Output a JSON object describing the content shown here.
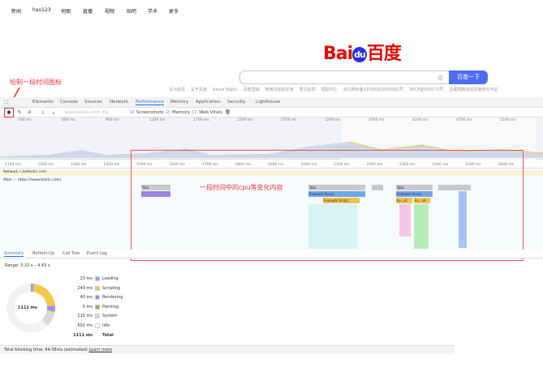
{
  "nav": [
    "新闻",
    "hao123",
    "地图",
    "直播",
    "视频",
    "贴吧",
    "学术",
    "更多"
  ],
  "logo": {
    "left": "Bai",
    "mid": "du",
    "right": "百度"
  },
  "search": {
    "button": "百度一下",
    "value": ""
  },
  "links": [
    "设为首页",
    "关于百度",
    "About Baidu",
    "百度营销",
    "使用百度前必读",
    "意见反馈",
    "帮助中心",
    "京公网安备11000002000001号",
    "京ICP证030173号",
    "互联网新闻信息服务许可证"
  ],
  "annotations": {
    "record": "绘制一段时间图标",
    "cpu": "一段时间中的cpu等变化内容"
  },
  "devtools": {
    "tabs": [
      "Elements",
      "Console",
      "Sources",
      "Network",
      "Performance",
      "Memory",
      "Application",
      "Security",
      "Lighthouse"
    ],
    "active_tab": "Performance",
    "toolbar": {
      "profile_select": "www.baidu.com #1",
      "screenshots": "Screenshots",
      "memory": "Memory",
      "web_vitals": "Web Vitals",
      "screenshots_checked": true,
      "memory_checked": true,
      "web_vitals_checked": false
    },
    "overview_ticks": [
      "100 ms",
      "600 ms",
      "900 ms",
      "1200 ms",
      "1700 ms",
      "2200 ms",
      "2700 ms",
      "3200 ms",
      "3700 ms",
      "4200 ms",
      "4700 ms",
      "5200 ms"
    ],
    "ruler_ticks": [
      "1100 ms",
      "1200 ms",
      "1300 ms",
      "1400 ms",
      "1500 ms",
      "1600 ms",
      "1700 ms",
      "1800 ms",
      "1900 ms",
      "2000 ms",
      "2100 ms",
      "2200 ms",
      "2300 ms",
      "2400 ms",
      "2500 ms",
      "2600 ms"
    ],
    "network_row": "Network  s.bdstatic.com",
    "main_row": "Main — https://www.baidu.com/",
    "flame": [
      {
        "label": "Task",
        "color": "#c8c8c8"
      },
      {
        "label": "Evaluate Script",
        "color": "#f2c14e"
      },
      {
        "label": "Evaluate Script",
        "color": "#f2c14e"
      },
      {
        "label": "Task",
        "color": "#c8c8c8"
      },
      {
        "label": "Evaluate Script",
        "color": "#6fa8f0"
      },
      {
        "label": "Task",
        "color": "#c8c8c8"
      },
      {
        "label": "Evaluate Script",
        "color": "#6fa8f0"
      },
      {
        "label": "Ev...pt",
        "color": "#f2c14e"
      },
      {
        "label": "Ev...ad",
        "color": "#f2c14e"
      }
    ],
    "bottom_tabs": [
      "Summary",
      "Bottom-Up",
      "Call Tree",
      "Event Log"
    ],
    "active_bottom_tab": "Summary",
    "range": "Range: 3.32 s – 4.43 s",
    "donut_total": "1111 ms",
    "summary": [
      {
        "value": "23 ms",
        "label": "Loading",
        "color": "#8fa3e8"
      },
      {
        "value": "240 ms",
        "label": "Scripting",
        "color": "#f2c94c"
      },
      {
        "value": "40 ms",
        "label": "Rendering",
        "color": "#a58be0"
      },
      {
        "value": "5 ms",
        "label": "Painting",
        "color": "#7fb36b"
      },
      {
        "value": "115 ms",
        "label": "System",
        "color": "#d9d9d9"
      },
      {
        "value": "691 ms",
        "label": "Idle",
        "color": "#ffffff"
      },
      {
        "value": "1111 ms",
        "label": "Total",
        "color": ""
      }
    ],
    "footer": {
      "text": "Total blocking time: 44.08ms (estimated)",
      "link": "Learn more"
    }
  }
}
